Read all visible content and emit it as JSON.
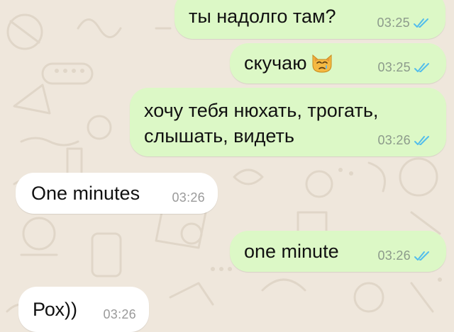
{
  "colors": {
    "background": "#efe7dc",
    "outgoing_bubble": "#dcf8c6",
    "incoming_bubble": "#ffffff",
    "read_ticks": "#53bdeb"
  },
  "messages": [
    {
      "direction": "outgoing",
      "text": "ты надолго там?",
      "time": "03:25",
      "status": "read"
    },
    {
      "direction": "outgoing",
      "text": "скучаю",
      "emoji": "crying-cat-face",
      "time": "03:25",
      "status": "read"
    },
    {
      "direction": "outgoing",
      "lines": [
        "хочу тебя нюхать, трогать,",
        "слышать, видеть"
      ],
      "time": "03:26",
      "status": "read"
    },
    {
      "direction": "incoming",
      "text": "One minutes",
      "time": "03:26"
    },
    {
      "direction": "outgoing",
      "text": "one minute",
      "time": "03:26",
      "status": "read"
    },
    {
      "direction": "incoming",
      "text": "Рох))",
      "time": "03:26"
    }
  ]
}
